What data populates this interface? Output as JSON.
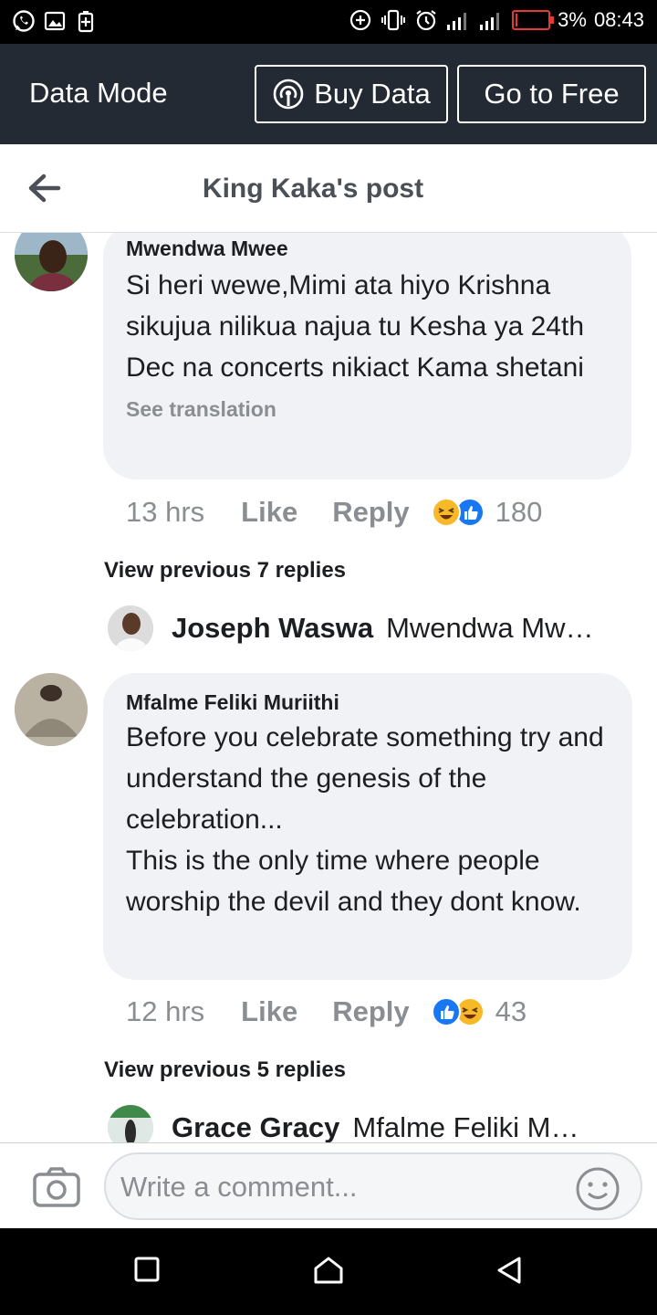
{
  "status_bar": {
    "battery_percent": "3%",
    "battery_level": 0.03,
    "time": "08:43",
    "left_icons": [
      "whatsapp-icon",
      "image-icon",
      "battery-saver-icon"
    ],
    "right_icons": [
      "data-saver-icon",
      "vibrate-icon",
      "alarm-icon",
      "signal-icon",
      "signal-icon",
      "battery-icon"
    ]
  },
  "data_bar": {
    "title": "Data Mode",
    "buy_label": "Buy Data",
    "free_label": "Go to Free"
  },
  "header": {
    "title": "King Kaka's post"
  },
  "comments": [
    {
      "author": "Mwendwa Mwee",
      "text": "Si heri wewe,Mimi ata hiyo Krishna sikujua nilikua najua tu Kesha ya 24th Dec na concerts nikiact Kama shetani",
      "see_translation": "See translation",
      "time": "13 hrs",
      "like": "Like",
      "reply": "Reply",
      "reaction_count": "180",
      "reactions": [
        "haha",
        "like"
      ],
      "view_previous": "View previous 7 replies",
      "last_reply": {
        "author": "Joseph Waswa",
        "text": "Mwendwa Mw…"
      }
    },
    {
      "author": "Mfalme Feliki Muriithi",
      "text": "Before you celebrate something try and understand the genesis of the celebration...\nThis is the only time where people worship the devil and they dont know.",
      "time": "12 hrs",
      "like": "Like",
      "reply": "Reply",
      "reaction_count": "43",
      "reactions": [
        "like",
        "haha"
      ],
      "view_previous": "View previous 5 replies",
      "last_reply": {
        "author": "Grace Gracy",
        "text": "Mfalme Feliki Mu…"
      }
    }
  ],
  "composer": {
    "placeholder": "Write a comment..."
  },
  "colors": {
    "data_bar_bg": "#232a33",
    "bubble_bg": "#f0f2f5",
    "like_blue": "#1877f2",
    "haha_yellow": "#f7b928",
    "battery_red": "#e53935"
  }
}
